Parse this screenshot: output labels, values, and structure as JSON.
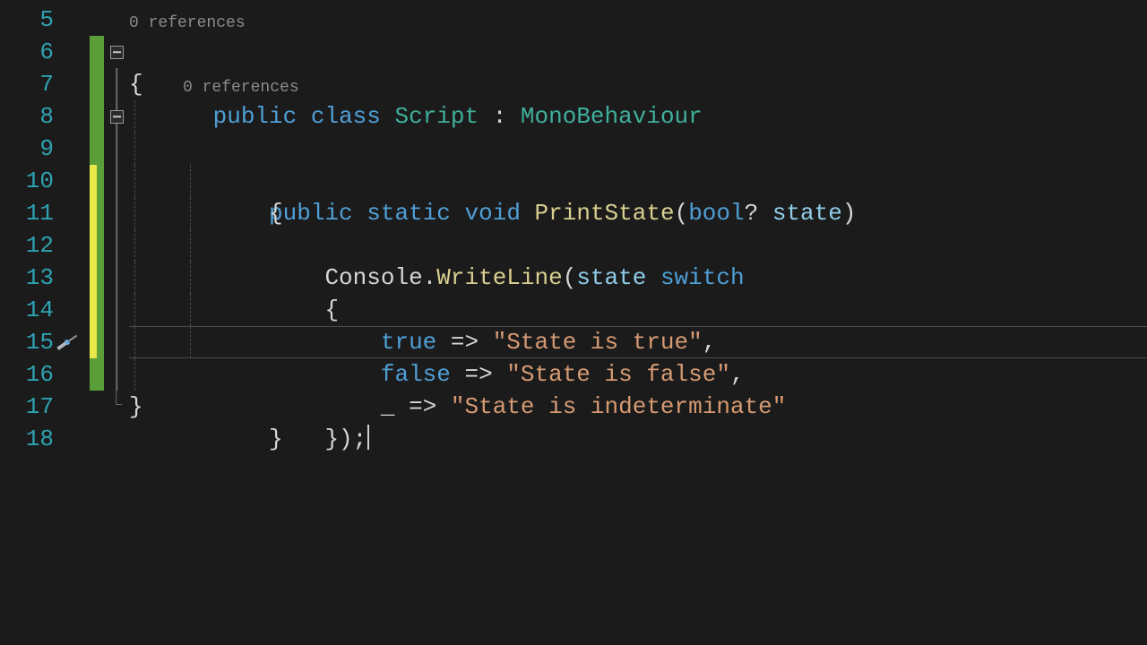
{
  "lineNumbers": [
    "5",
    "6",
    "7",
    "8",
    "9",
    "10",
    "11",
    "12",
    "13",
    "14",
    "15",
    "16",
    "17",
    "18"
  ],
  "codelens": {
    "class": "0 references",
    "method": "0 references"
  },
  "code": {
    "l6": {
      "public": "public",
      "class": "class",
      "Script": "Script",
      "colon": " : ",
      "Mono": "MonoBehaviour"
    },
    "l7": "{",
    "l8": {
      "public": "public",
      "static": "static",
      "void": "void",
      "Print": "PrintState",
      "lp": "(",
      "bool": "bool",
      "q": "?",
      "sp": " ",
      "state": "state",
      "rp": ")"
    },
    "l9": "{",
    "l10": {
      "Console": "Console",
      "dot": ".",
      "WriteLine": "WriteLine",
      "lp": "(",
      "state": "state",
      "sp": " ",
      "switch": "switch"
    },
    "l11": "{",
    "l12": {
      "true": "true",
      "arrow": " => ",
      "str": "\"State is true\"",
      "comma": ","
    },
    "l13": {
      "false": "false",
      "arrow": " => ",
      "str": "\"State is false\"",
      "comma": ","
    },
    "l14": {
      "under": "_",
      "arrow": " => ",
      "str": "\"State is indeterminate\""
    },
    "l15": "});",
    "l16": "}",
    "l17": "}"
  },
  "currentLineIndex": 10
}
